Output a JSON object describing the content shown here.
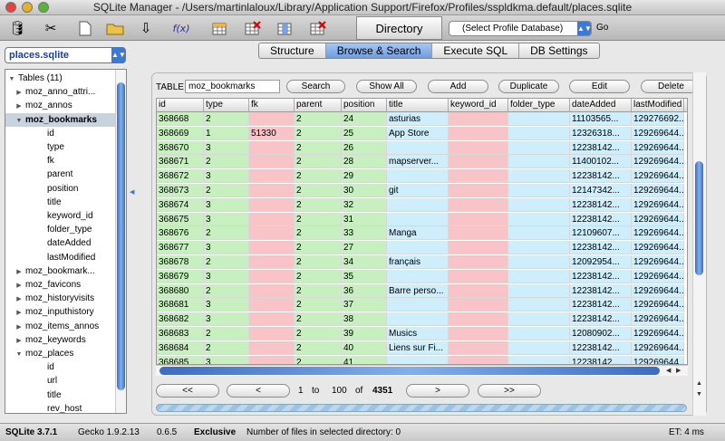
{
  "window": {
    "title": "SQLite Manager - /Users/martinlaloux/Library/Application Support/Firefox/Profiles/sspldkma.default/places.sqlite"
  },
  "toolbar": {
    "directory_label": "Directory",
    "profile_select": "(Select Profile Database)",
    "go_label": "Go"
  },
  "db_select": "places.sqlite",
  "tabs": [
    "Structure",
    "Browse & Search",
    "Execute SQL",
    "DB Settings"
  ],
  "tree": [
    {
      "label": "Tables (11)",
      "level": 0,
      "tri": "down"
    },
    {
      "label": "moz_anno_attri...",
      "level": 1,
      "tri": "right"
    },
    {
      "label": "moz_annos",
      "level": 1,
      "tri": "right"
    },
    {
      "label": "moz_bookmarks",
      "level": 1,
      "tri": "down",
      "selected": true
    },
    {
      "label": "id",
      "level": 2
    },
    {
      "label": "type",
      "level": 2
    },
    {
      "label": "fk",
      "level": 2
    },
    {
      "label": "parent",
      "level": 2
    },
    {
      "label": "position",
      "level": 2
    },
    {
      "label": "title",
      "level": 2
    },
    {
      "label": "keyword_id",
      "level": 2
    },
    {
      "label": "folder_type",
      "level": 2
    },
    {
      "label": "dateAdded",
      "level": 2
    },
    {
      "label": "lastModified",
      "level": 2
    },
    {
      "label": "moz_bookmark...",
      "level": 1,
      "tri": "right"
    },
    {
      "label": "moz_favicons",
      "level": 1,
      "tri": "right"
    },
    {
      "label": "moz_historyvisits",
      "level": 1,
      "tri": "right"
    },
    {
      "label": "moz_inputhistory",
      "level": 1,
      "tri": "right"
    },
    {
      "label": "moz_items_annos",
      "level": 1,
      "tri": "right"
    },
    {
      "label": "moz_keywords",
      "level": 1,
      "tri": "right"
    },
    {
      "label": "moz_places",
      "level": 1,
      "tri": "down"
    },
    {
      "label": "id",
      "level": 2
    },
    {
      "label": "url",
      "level": 2
    },
    {
      "label": "title",
      "level": 2
    },
    {
      "label": "rev_host",
      "level": 2
    }
  ],
  "browse": {
    "table_label": "TABLE",
    "table_value": "moz_bookmarks",
    "buttons": {
      "search": "Search",
      "show_all": "Show All",
      "add": "Add",
      "duplicate": "Duplicate",
      "edit": "Edit",
      "delete": "Delete"
    }
  },
  "grid": {
    "columns": [
      "id",
      "type",
      "fk",
      "parent",
      "position",
      "title",
      "keyword_id",
      "folder_type",
      "dateAdded",
      "lastModified"
    ],
    "column_colors": [
      "green",
      "green",
      "pink",
      "green",
      "green",
      "blue",
      "pink",
      "blue",
      "blue",
      "blue"
    ],
    "rows": [
      [
        "368668",
        "2",
        "",
        "2",
        "24",
        "asturias",
        "",
        "",
        "11103565...",
        "129276692..."
      ],
      [
        "368669",
        "1",
        "51330",
        "2",
        "25",
        "App Store",
        "",
        "",
        "12326318...",
        "129269644..."
      ],
      [
        "368670",
        "3",
        "",
        "2",
        "26",
        "",
        "",
        "",
        "12238142...",
        "129269644..."
      ],
      [
        "368671",
        "2",
        "",
        "2",
        "28",
        "mapserver...",
        "",
        "",
        "11400102...",
        "129269644..."
      ],
      [
        "368672",
        "3",
        "",
        "2",
        "29",
        "",
        "",
        "",
        "12238142...",
        "129269644..."
      ],
      [
        "368673",
        "2",
        "",
        "2",
        "30",
        "git",
        "",
        "",
        "12147342...",
        "129269644..."
      ],
      [
        "368674",
        "3",
        "",
        "2",
        "32",
        "",
        "",
        "",
        "12238142...",
        "129269644..."
      ],
      [
        "368675",
        "3",
        "",
        "2",
        "31",
        "",
        "",
        "",
        "12238142...",
        "129269644..."
      ],
      [
        "368676",
        "2",
        "",
        "2",
        "33",
        "Manga",
        "",
        "",
        "12109607...",
        "129269644..."
      ],
      [
        "368677",
        "3",
        "",
        "2",
        "27",
        "",
        "",
        "",
        "12238142...",
        "129269644..."
      ],
      [
        "368678",
        "2",
        "",
        "2",
        "34",
        "français",
        "",
        "",
        "12092954...",
        "129269644..."
      ],
      [
        "368679",
        "3",
        "",
        "2",
        "35",
        "",
        "",
        "",
        "12238142...",
        "129269644..."
      ],
      [
        "368680",
        "2",
        "",
        "2",
        "36",
        "Barre perso...",
        "",
        "",
        "12238142...",
        "129269644..."
      ],
      [
        "368681",
        "3",
        "",
        "2",
        "37",
        "",
        "",
        "",
        "12238142...",
        "129269644..."
      ],
      [
        "368682",
        "3",
        "",
        "2",
        "38",
        "",
        "",
        "",
        "12238142...",
        "129269644..."
      ],
      [
        "368683",
        "2",
        "",
        "2",
        "39",
        "Musics",
        "",
        "",
        "12080902...",
        "129269644..."
      ],
      [
        "368684",
        "2",
        "",
        "2",
        "40",
        "Liens sur Fi...",
        "",
        "",
        "12238142...",
        "129269644..."
      ],
      [
        "368685",
        "3",
        "",
        "2",
        "41",
        "",
        "",
        "",
        "12238142...",
        "129269644..."
      ]
    ]
  },
  "pager": {
    "first": "<<",
    "prev": "<",
    "from": "1",
    "to_word": "to",
    "to": "100",
    "of_word": "of",
    "total": "4351",
    "next": ">",
    "last": ">>"
  },
  "progress_fraction": 0.0,
  "status": {
    "sqlite": "SQLite 3.7.1",
    "gecko": "Gecko 1.9.2.13",
    "version": "0.6.5",
    "mode": "Exclusive",
    "files": "Number of files in selected directory: 0",
    "et": "ET: 4 ms"
  },
  "colors": {
    "green": "#c7efc0",
    "pink": "#f8c4c8",
    "blue": "#cdeefa",
    "accent": "#3c79d2"
  }
}
